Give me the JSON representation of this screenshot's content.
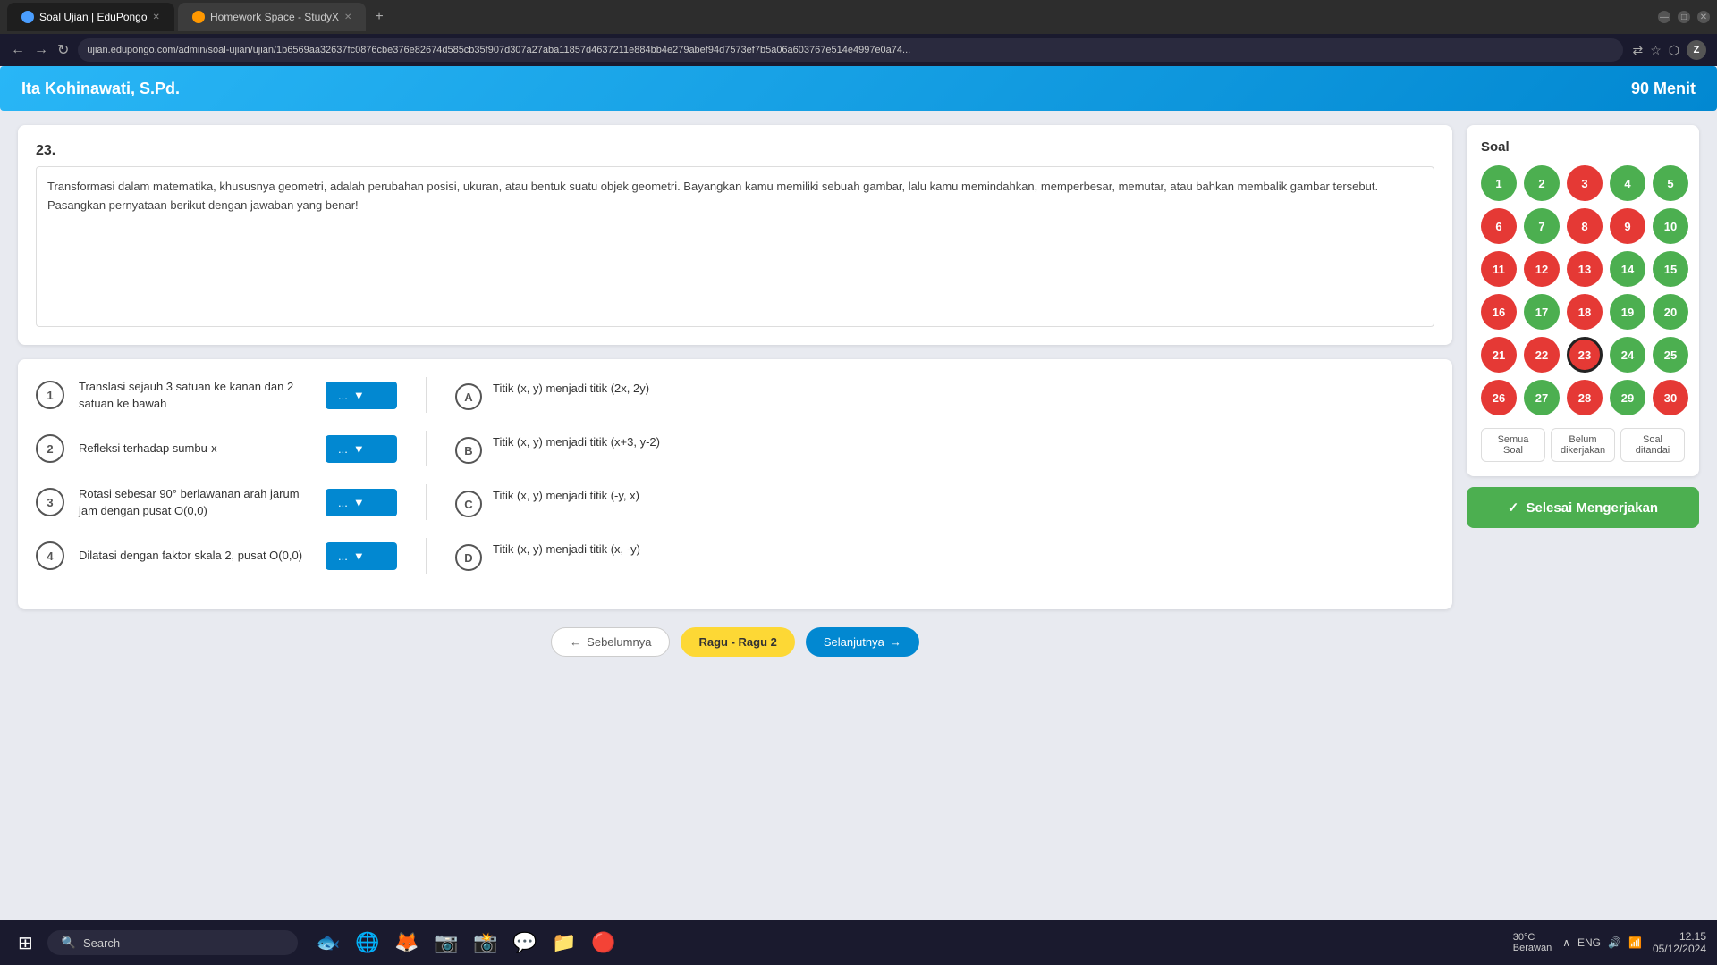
{
  "browser": {
    "tabs": [
      {
        "id": 1,
        "label": "Soal Ujian | EduPongo",
        "active": true,
        "icon": "edu-icon"
      },
      {
        "id": 2,
        "label": "Homework Space - StudyX",
        "active": false,
        "icon": "study-icon"
      }
    ],
    "url": "ujian.edupongo.com/admin/soal-ujian/ujian/1b6569aa32637fc0876cbe376e82674d585cb35f907d307a27aba11857d4637211e884bb4e279abef94d7573ef7b5a06a603767e514e4997e0a74...",
    "window_controls": {
      "minimize": "—",
      "maximize": "□",
      "close": "✕"
    }
  },
  "header": {
    "teacher": "Ita Kohinawati, S.Pd.",
    "duration": "90 Menit"
  },
  "question": {
    "number": "23.",
    "text": "Transformasi dalam matematika, khususnya geometri, adalah perubahan posisi, ukuran, atau bentuk suatu objek geometri. Bayangkan kamu memiliki sebuah gambar, lalu kamu memindahkan, memperbesar, memutar, atau bahkan membalik gambar tersebut. Pasangkan pernyataan berikut dengan jawaban yang benar!"
  },
  "matching": {
    "left_items": [
      {
        "number": "1",
        "text": "Translasi sejauh 3 satuan ke kanan dan 2 satuan ke bawah"
      },
      {
        "number": "2",
        "text": "Refleksi terhadap sumbu-x"
      },
      {
        "number": "3",
        "text": "Rotasi sebesar 90° berlawanan arah jarum jam dengan pusat O(0,0)"
      },
      {
        "number": "4",
        "text": "Dilatasi dengan faktor skala 2, pusat O(0,0)"
      }
    ],
    "right_items": [
      {
        "letter": "A",
        "text": "Titik (x, y) menjadi titik (2x, 2y)"
      },
      {
        "letter": "B",
        "text": "Titik (x, y) menjadi titik (x+3, y-2)"
      },
      {
        "letter": "C",
        "text": "Titik (x, y) menjadi titik (-y, x)"
      },
      {
        "letter": "D",
        "text": "Titik (x, y) menjadi titik (x, -y)"
      }
    ],
    "dropdown_label": "..."
  },
  "soal_panel": {
    "title": "Soal",
    "numbers": [
      {
        "n": 1,
        "color": "green"
      },
      {
        "n": 2,
        "color": "green"
      },
      {
        "n": 3,
        "color": "red"
      },
      {
        "n": 4,
        "color": "green"
      },
      {
        "n": 5,
        "color": "green"
      },
      {
        "n": 6,
        "color": "red"
      },
      {
        "n": 7,
        "color": "green"
      },
      {
        "n": 8,
        "color": "red"
      },
      {
        "n": 9,
        "color": "red"
      },
      {
        "n": 10,
        "color": "green"
      },
      {
        "n": 11,
        "color": "red"
      },
      {
        "n": 12,
        "color": "red"
      },
      {
        "n": 13,
        "color": "red"
      },
      {
        "n": 14,
        "color": "green"
      },
      {
        "n": 15,
        "color": "green"
      },
      {
        "n": 16,
        "color": "red"
      },
      {
        "n": 17,
        "color": "green"
      },
      {
        "n": 18,
        "color": "red"
      },
      {
        "n": 19,
        "color": "green"
      },
      {
        "n": 20,
        "color": "green"
      },
      {
        "n": 21,
        "color": "red"
      },
      {
        "n": 22,
        "color": "red"
      },
      {
        "n": 23,
        "color": "current"
      },
      {
        "n": 24,
        "color": "green"
      },
      {
        "n": 25,
        "color": "green"
      },
      {
        "n": 26,
        "color": "red"
      },
      {
        "n": 27,
        "color": "green"
      },
      {
        "n": 28,
        "color": "red"
      },
      {
        "n": 29,
        "color": "green"
      },
      {
        "n": 30,
        "color": "red"
      }
    ],
    "filters": [
      {
        "label": "Semua Soal"
      },
      {
        "label": "Belum dikerjakan"
      },
      {
        "label": "Soal ditandai"
      }
    ],
    "selesai_btn": "✓ Selesai Mengerjakan"
  },
  "nav_buttons": {
    "prev": "← Sebelumnya",
    "page": "Ragu - Ragu 2",
    "next": "Selanjutnya →"
  },
  "taskbar": {
    "search_placeholder": "Search",
    "weather": {
      "temp": "30°C",
      "condition": "Berawan"
    },
    "time": "12.15",
    "date": "05/12/2024",
    "language": "ENG"
  }
}
